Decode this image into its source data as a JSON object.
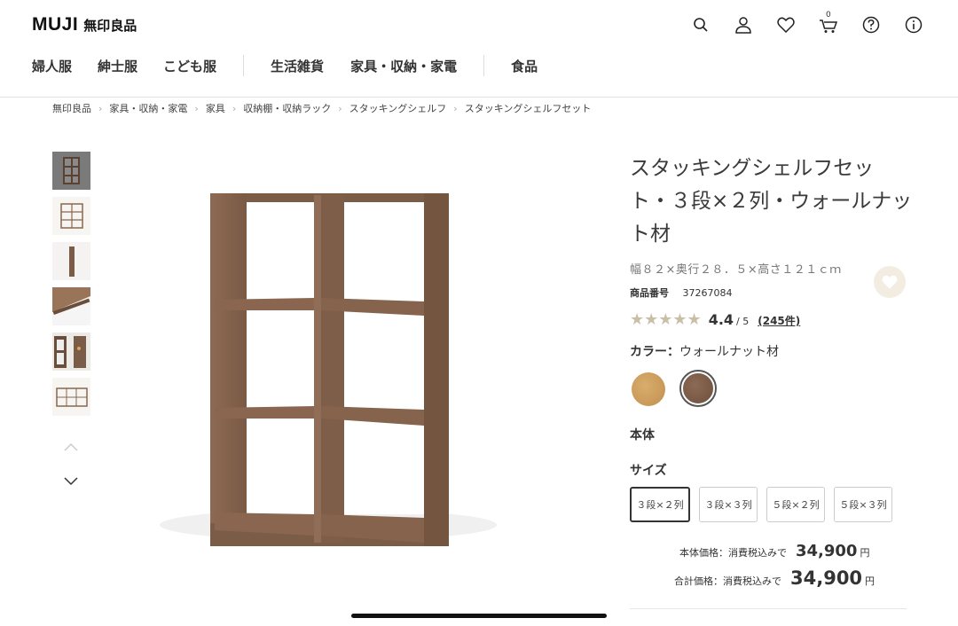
{
  "header": {
    "logo_text": "MUJI",
    "logo_jp": "無印良品",
    "icons": [
      "search-icon",
      "account-icon",
      "heart-icon",
      "cart-icon",
      "help-icon",
      "info-icon"
    ],
    "cart_count": "0"
  },
  "nav": {
    "items": [
      "婦人服",
      "紳士服",
      "こども服",
      "生活雑貨",
      "家具・収納・家電",
      "食品"
    ]
  },
  "breadcrumb": [
    "無印良品",
    "家具・収納・家電",
    "家具",
    "収納棚・収納ラック",
    "スタッキングシェルフ",
    "スタッキングシェルフセット"
  ],
  "product": {
    "title": "スタッキングシェルフセット・３段×２列・ウォールナット材",
    "dimensions": "幅８２×奥行２８．５×高さ１２１ｃｍ",
    "sku_label": "商品番号",
    "sku": "37267084",
    "rating": {
      "stars": "★★★★★",
      "value": "4.4",
      "max": "/ 5",
      "count": "(245件)"
    },
    "color_label": "カラー：",
    "color_value": "ウォールナット材",
    "colors": [
      {
        "name": "oak",
        "hex": "#c9975a"
      },
      {
        "name": "walnut",
        "hex": "#7b5c47"
      }
    ],
    "body_label": "本体",
    "size_label": "サイズ",
    "sizes": [
      "３段×２列",
      "３段×３列",
      "５段×２列",
      "５段×３列"
    ],
    "selected_size": "３段×２列",
    "price_label": "本体価格：消費税込みで",
    "price": "34,900",
    "total_label": "合計価格：消費税込みで",
    "total": "34,900",
    "yen": "円"
  },
  "colors": {
    "wood": "#8a6650",
    "wood_dark": "#6b4d3b",
    "wood_light": "#9e7a62"
  }
}
